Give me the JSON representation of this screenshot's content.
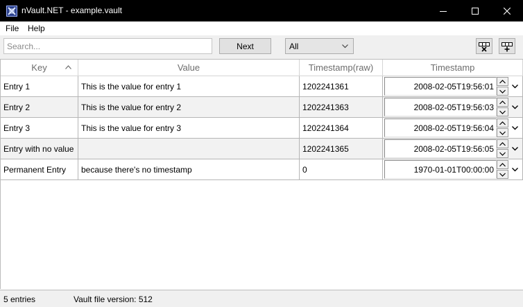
{
  "window": {
    "title": "nVault.NET - example.vault",
    "icon": "nvault-app-icon",
    "controls": [
      "minimize-icon",
      "maximize-icon",
      "close-icon"
    ]
  },
  "menu": {
    "items": [
      {
        "label": "File"
      },
      {
        "label": "Help"
      }
    ]
  },
  "toolbar": {
    "search_placeholder": "Search...",
    "search_value": "",
    "next_label": "Next",
    "filter_value": "All",
    "filter_icon": "chevron-down-icon",
    "buttons": [
      {
        "name": "delete-entry-button",
        "icon": "delete-entry-icon"
      },
      {
        "name": "add-entry-button",
        "icon": "add-entry-icon"
      }
    ]
  },
  "grid": {
    "columns": [
      {
        "label": "Key",
        "sorted": "ascending"
      },
      {
        "label": "Value"
      },
      {
        "label": "Timestamp(raw)"
      },
      {
        "label": "Timestamp"
      }
    ],
    "rows": [
      {
        "key": "Entry 1",
        "value": "This is the value for entry 1",
        "raw": "1202241361",
        "timestamp": "2008-02-05T19:56:01"
      },
      {
        "key": "Entry 2",
        "value": "This is the value for entry 2",
        "raw": "1202241363",
        "timestamp": "2008-02-05T19:56:03"
      },
      {
        "key": "Entry 3",
        "value": "This is the value for entry 3",
        "raw": "1202241364",
        "timestamp": "2008-02-05T19:56:04"
      },
      {
        "key": "Entry with no value",
        "value": "",
        "raw": "1202241365",
        "timestamp": "2008-02-05T19:56:05"
      },
      {
        "key": "Permanent Entry",
        "value": "because there's no timestamp",
        "raw": "0",
        "timestamp": "1970-01-01T00:00:00"
      }
    ],
    "alternate_row_color": "#f2f2f2"
  },
  "status": {
    "entries": "5 entries",
    "version": "Vault file version: 512"
  },
  "colors": {
    "titlebar": "#000000",
    "toolbar": "#f0f0f0",
    "header_text": "#6d6d6d"
  }
}
